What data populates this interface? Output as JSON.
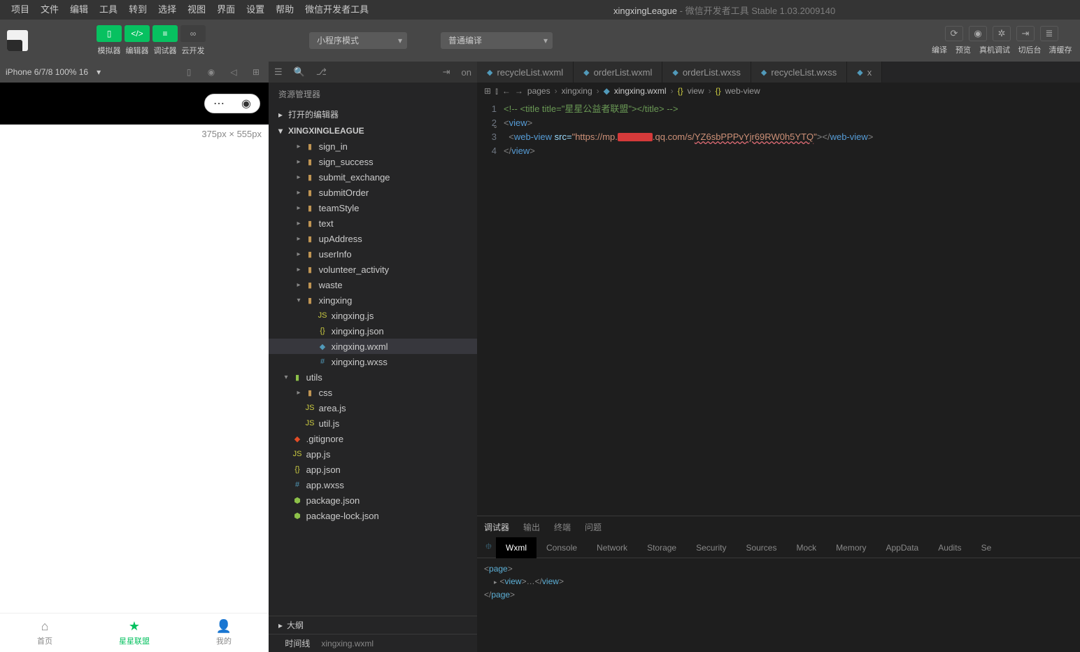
{
  "menubar": [
    "项目",
    "文件",
    "编辑",
    "工具",
    "转到",
    "选择",
    "视图",
    "界面",
    "设置",
    "帮助",
    "微信开发者工具"
  ],
  "windowTitle": {
    "project": "xingxingLeague",
    "suffix": " - 微信开发者工具 Stable 1.03.2009140"
  },
  "modeLabels": [
    "模拟器",
    "编辑器",
    "调试器",
    "云开发"
  ],
  "smallProgramMode": "小程序模式",
  "compileMode": "普通编译",
  "compileActionLabels": [
    "编译",
    "预览",
    "真机调试",
    "切后台",
    "清缓存"
  ],
  "simHeader": {
    "device": "iPhone 6/7/8 100% 16",
    "arrow": "▾"
  },
  "simDims": "375px × 555px",
  "tabbar": [
    {
      "icon": "⌂",
      "label": "首页"
    },
    {
      "icon": "★",
      "label": "星星联盟"
    },
    {
      "icon": "👤",
      "label": "我的"
    }
  ],
  "explorer": {
    "title": "资源管理器",
    "section1": "打开的编辑器",
    "project": "XINGXINGLEAGUE",
    "tree": [
      {
        "d": 2,
        "t": "folder",
        "c": "▸",
        "n": "sign_in"
      },
      {
        "d": 2,
        "t": "folder",
        "c": "▸",
        "n": "sign_success"
      },
      {
        "d": 2,
        "t": "folder",
        "c": "▸",
        "n": "submit_exchange"
      },
      {
        "d": 2,
        "t": "folder",
        "c": "▸",
        "n": "submitOrder"
      },
      {
        "d": 2,
        "t": "folder",
        "c": "▸",
        "n": "teamStyle"
      },
      {
        "d": 2,
        "t": "folder",
        "c": "▸",
        "n": "text"
      },
      {
        "d": 2,
        "t": "folder",
        "c": "▸",
        "n": "upAddress"
      },
      {
        "d": 2,
        "t": "folder",
        "c": "▸",
        "n": "userInfo"
      },
      {
        "d": 2,
        "t": "folder",
        "c": "▸",
        "n": "volunteer_activity"
      },
      {
        "d": 2,
        "t": "folder",
        "c": "▸",
        "n": "waste"
      },
      {
        "d": 2,
        "t": "folder",
        "c": "▾",
        "n": "xingxing"
      },
      {
        "d": 3,
        "t": "js",
        "c": "",
        "n": "xingxing.js"
      },
      {
        "d": 3,
        "t": "json",
        "c": "",
        "n": "xingxing.json"
      },
      {
        "d": 3,
        "t": "wxml",
        "c": "",
        "n": "xingxing.wxml",
        "sel": true
      },
      {
        "d": 3,
        "t": "wxss",
        "c": "",
        "n": "xingxing.wxss"
      },
      {
        "d": 1,
        "t": "folder-green",
        "c": "▾",
        "n": "utils"
      },
      {
        "d": 2,
        "t": "folder",
        "c": "▸",
        "n": "css"
      },
      {
        "d": 2,
        "t": "js",
        "c": "",
        "n": "area.js"
      },
      {
        "d": 2,
        "t": "js",
        "c": "",
        "n": "util.js"
      },
      {
        "d": 1,
        "t": "git",
        "c": "",
        "n": ".gitignore"
      },
      {
        "d": 1,
        "t": "js",
        "c": "",
        "n": "app.js"
      },
      {
        "d": 1,
        "t": "json",
        "c": "",
        "n": "app.json"
      },
      {
        "d": 1,
        "t": "wxss",
        "c": "",
        "n": "app.wxss"
      },
      {
        "d": 1,
        "t": "pkg",
        "c": "",
        "n": "package.json"
      },
      {
        "d": 1,
        "t": "pkg",
        "c": "",
        "n": "package-lock.json"
      }
    ],
    "outline": "大纲",
    "timeline": "时间线",
    "timelineFile": "xingxing.wxml"
  },
  "editorTabs": [
    {
      "ic": "wxml",
      "label": "recycleList.wxml"
    },
    {
      "ic": "wxml",
      "label": "orderList.wxml"
    },
    {
      "ic": "wxss",
      "label": "orderList.wxss"
    },
    {
      "ic": "wxss",
      "label": "recycleList.wxss"
    },
    {
      "ic": "wxml",
      "label": "x",
      "trunc": true
    }
  ],
  "breadcrumb": [
    "pages",
    "xingxing",
    "xingxing.wxml",
    "view",
    "web-view"
  ],
  "breadcrumbIcons": [
    "",
    "",
    "wxml",
    "json",
    "json"
  ],
  "code": {
    "l1": "<!-- <title title=\"星星公益者联盟\"></title> -->",
    "l2": {
      "open": "<",
      "tag": "view",
      "close": ">"
    },
    "l3": {
      "open": "<",
      "tag": "web-view",
      "attr": " src=",
      "q": "\"",
      "url1": "https://mp.",
      "url2": ".qq.com/s/",
      "url3": "YZ6sbPPPvYjr69RW0h5YTQ",
      "endq": "\"",
      "close": ">",
      "ctag": "</web-view>"
    },
    "l4": {
      "open": "</",
      "tag": "view",
      "close": ">"
    }
  },
  "debugger": {
    "tabs": [
      "调试器",
      "输出",
      "终端",
      "问题"
    ],
    "subtabs": [
      "Wxml",
      "Console",
      "Network",
      "Storage",
      "Security",
      "Sources",
      "Mock",
      "Memory",
      "AppData",
      "Audits",
      "Se"
    ],
    "dom": {
      "page": "page",
      "view": "view",
      "dots": "…"
    }
  },
  "editorOn": "on"
}
